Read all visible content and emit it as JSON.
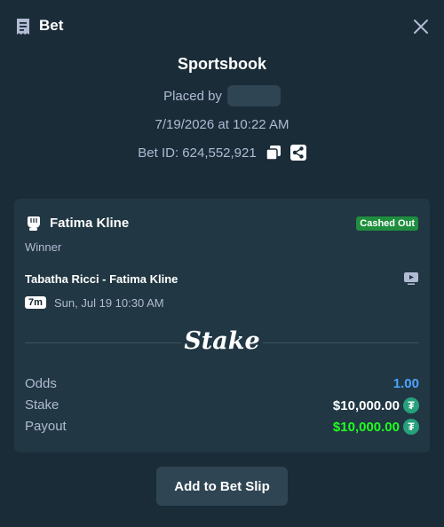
{
  "header": {
    "title": "Bet"
  },
  "summary": {
    "book": "Sportsbook",
    "placed_by_label": "Placed by",
    "datetime": "7/19/2026 at 10:22 AM",
    "bet_id": "Bet ID: 624,552,921"
  },
  "card": {
    "selection": "Fatima Kline",
    "status": "Cashed Out",
    "market": "Winner",
    "event": "Tabatha Ricci - Fatima Kline",
    "live_time": "7m",
    "start": "Sun, Jul 19  10:30 AM",
    "logo": "Stake",
    "rows": [
      {
        "label": "Odds",
        "value": "1.00",
        "color": "#4da3ff"
      },
      {
        "label": "Stake",
        "value": "$10,000.00",
        "color": "#ffffff"
      },
      {
        "label": "Payout",
        "value": "$10,000.00",
        "color": "#1fff20"
      }
    ],
    "currency_icon": "tether-icon"
  },
  "actions": {
    "add_label": "Add to Bet Slip"
  },
  "colors": {
    "background": "#1a2c38",
    "card": "#213743",
    "badge": "#1e8e3e",
    "accent_blue": "#4da3ff",
    "payout_green": "#1fff20"
  }
}
